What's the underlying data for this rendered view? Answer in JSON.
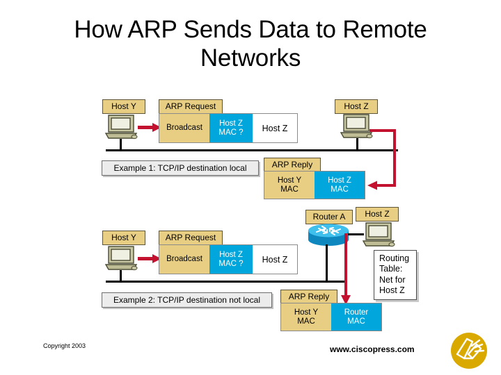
{
  "slide": {
    "title": "How ARP Sends Data to Remote Networks",
    "background_color": "#FFFFFF"
  },
  "palette": {
    "tan": "#E8CE83",
    "blue": "#00A6DC",
    "red": "#C31230",
    "gray_box": "#ECECEC",
    "logo_gold": "#D9A900",
    "pc_body": "#B9B892",
    "router_blue": "#1F9FD4"
  },
  "diagram": {
    "example1": {
      "caption": "Example 1: TCP/IP destination local",
      "host_y_label": "Host Y",
      "host_z_label": "Host Z",
      "arp_request_label": "ARP Request",
      "arp_request_fields": [
        {
          "text": "Broadcast",
          "style": "tan"
        },
        {
          "text": "Host Z\nMAC ?",
          "style": "blue"
        },
        {
          "text": "Host Z",
          "style": "white"
        }
      ],
      "arp_reply_label": "ARP Reply",
      "arp_reply_fields": [
        {
          "text": "Host Y\nMAC",
          "style": "tan"
        },
        {
          "text": "Host Z\nMAC",
          "style": "blue"
        }
      ]
    },
    "example2": {
      "caption": "Example 2: TCP/IP destination not local",
      "host_y_label": "Host Y",
      "host_z_label": "Host Z",
      "router_label": "Router A",
      "arp_request_label": "ARP Request",
      "arp_request_fields": [
        {
          "text": "Broadcast",
          "style": "tan"
        },
        {
          "text": "Host Z\nMAC ?",
          "style": "blue"
        },
        {
          "text": "Host Z",
          "style": "white"
        }
      ],
      "arp_reply_label": "ARP Reply",
      "arp_reply_fields": [
        {
          "text": "Host Y\nMAC",
          "style": "tan"
        },
        {
          "text": "Router\nMAC",
          "style": "blue"
        }
      ],
      "routing_table": "Routing\nTable:\nNet for\nHost Z"
    }
  },
  "footer": {
    "copyright": "Copyright 2003",
    "url": "www.ciscopress.com",
    "logo_name": "ciscopress-logo"
  }
}
